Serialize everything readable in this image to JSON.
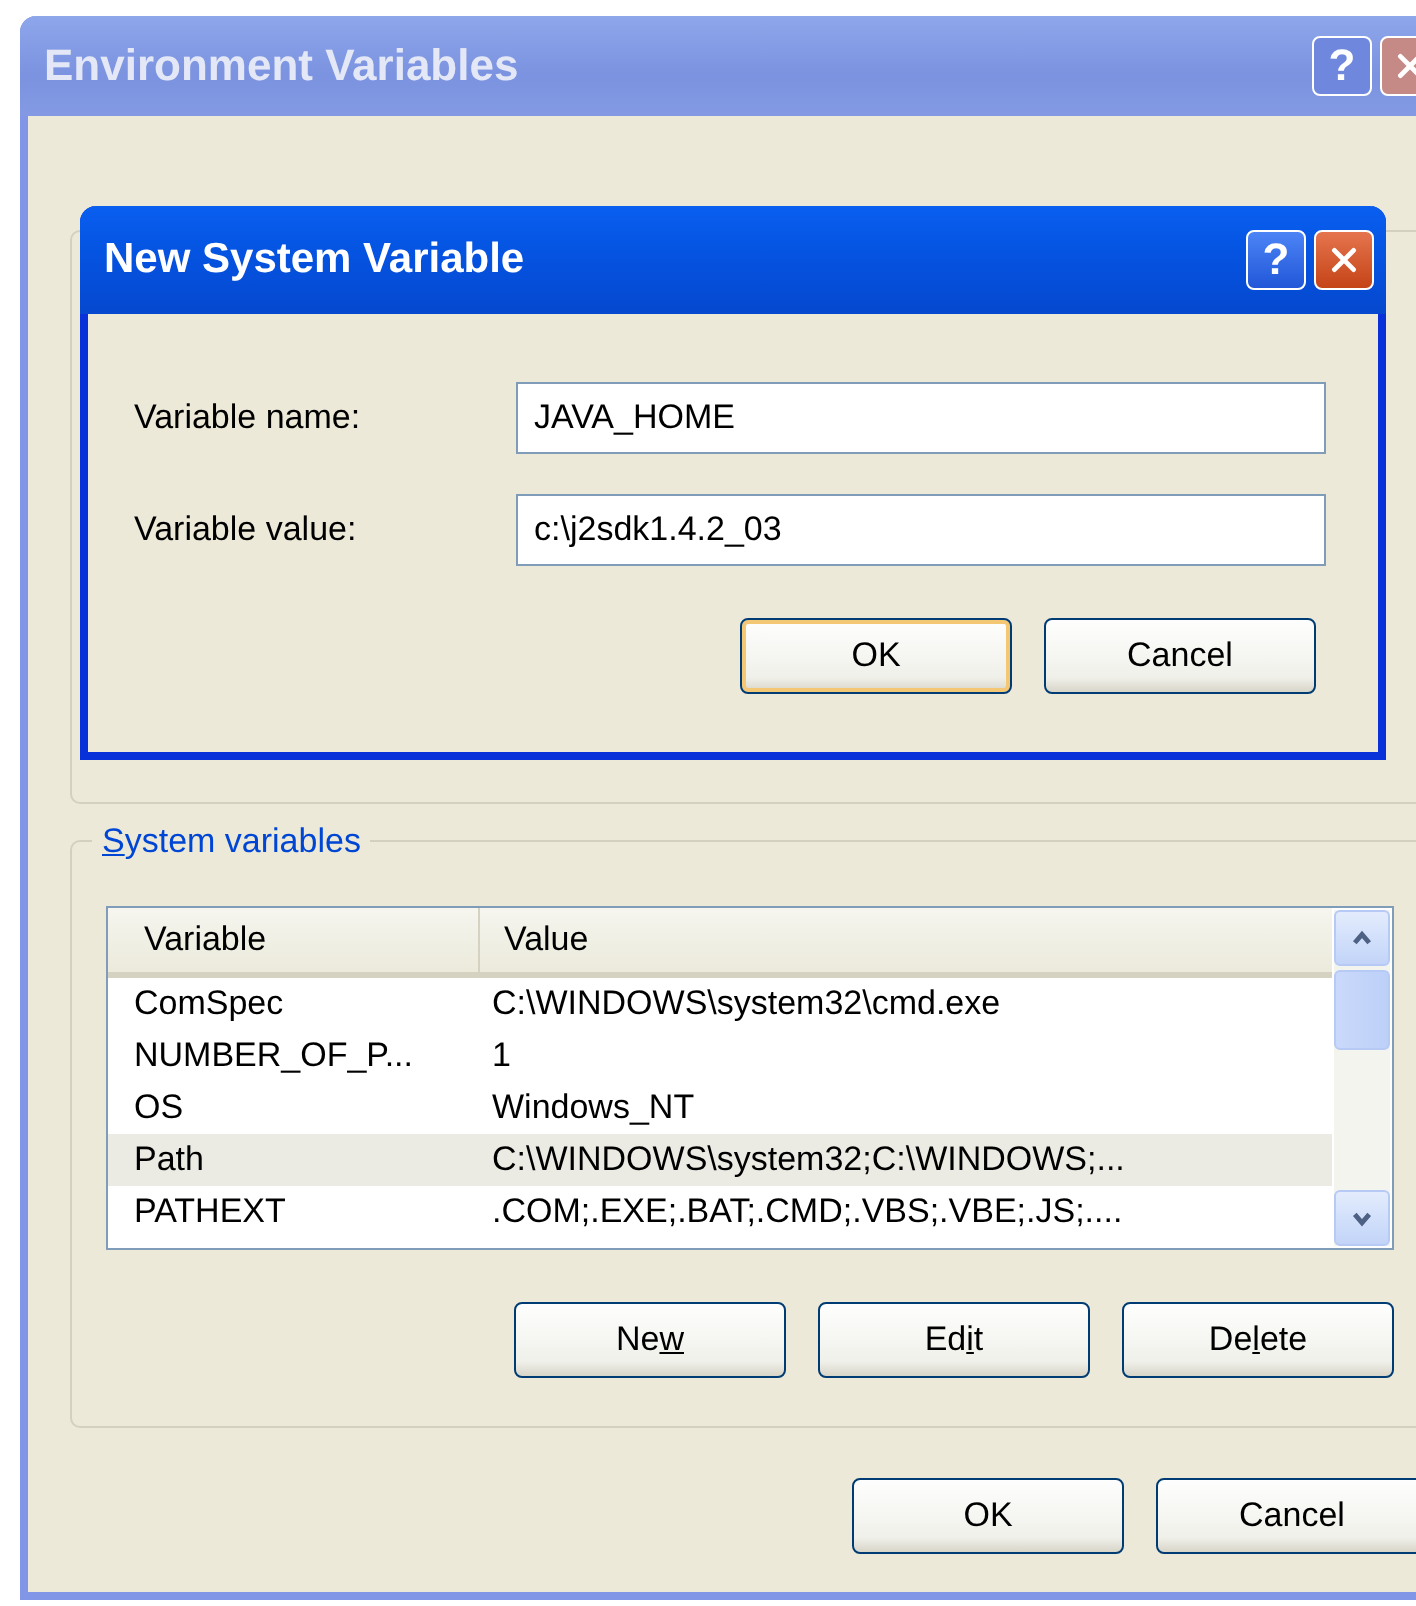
{
  "window": {
    "title": "Environment Variables",
    "help_label": "?",
    "active": false
  },
  "dialog": {
    "title": "New System Variable",
    "help_label": "?",
    "active": true,
    "fields": [
      {
        "label": "Variable name:",
        "value": "JAVA_HOME"
      },
      {
        "label": "Variable value:",
        "value": "c:\\j2sdk1.4.2_03"
      }
    ],
    "buttons": [
      {
        "label": "OK",
        "default": true
      },
      {
        "label": "Cancel",
        "default": false
      }
    ]
  },
  "system_variables": {
    "legend_parts": {
      "mnemonic": "S",
      "after": "ystem variables"
    },
    "columns": [
      "Variable",
      "Value"
    ],
    "rows": [
      {
        "variable": "ComSpec",
        "value": "C:\\WINDOWS\\system32\\cmd.exe",
        "selected": false
      },
      {
        "variable": "NUMBER_OF_P...",
        "value": "1",
        "selected": false
      },
      {
        "variable": "OS",
        "value": "Windows_NT",
        "selected": false
      },
      {
        "variable": "Path",
        "value": "C:\\WINDOWS\\system32;C:\\WINDOWS;...",
        "selected": true
      },
      {
        "variable": "PATHEXT",
        "value": ".COM;.EXE;.BAT;.CMD;.VBS;.VBE;.JS;....",
        "selected": false
      }
    ],
    "buttons": [
      {
        "label_parts": {
          "before": "Ne",
          "mnemonic": "w"
        }
      },
      {
        "label_parts": {
          "before": "Ed",
          "mnemonic": "i",
          "after": "t"
        }
      },
      {
        "label_parts": {
          "before": "De",
          "mnemonic": "l",
          "after": "ete"
        }
      }
    ]
  },
  "buttons": [
    {
      "label": "OK"
    },
    {
      "label": "Cancel"
    }
  ]
}
